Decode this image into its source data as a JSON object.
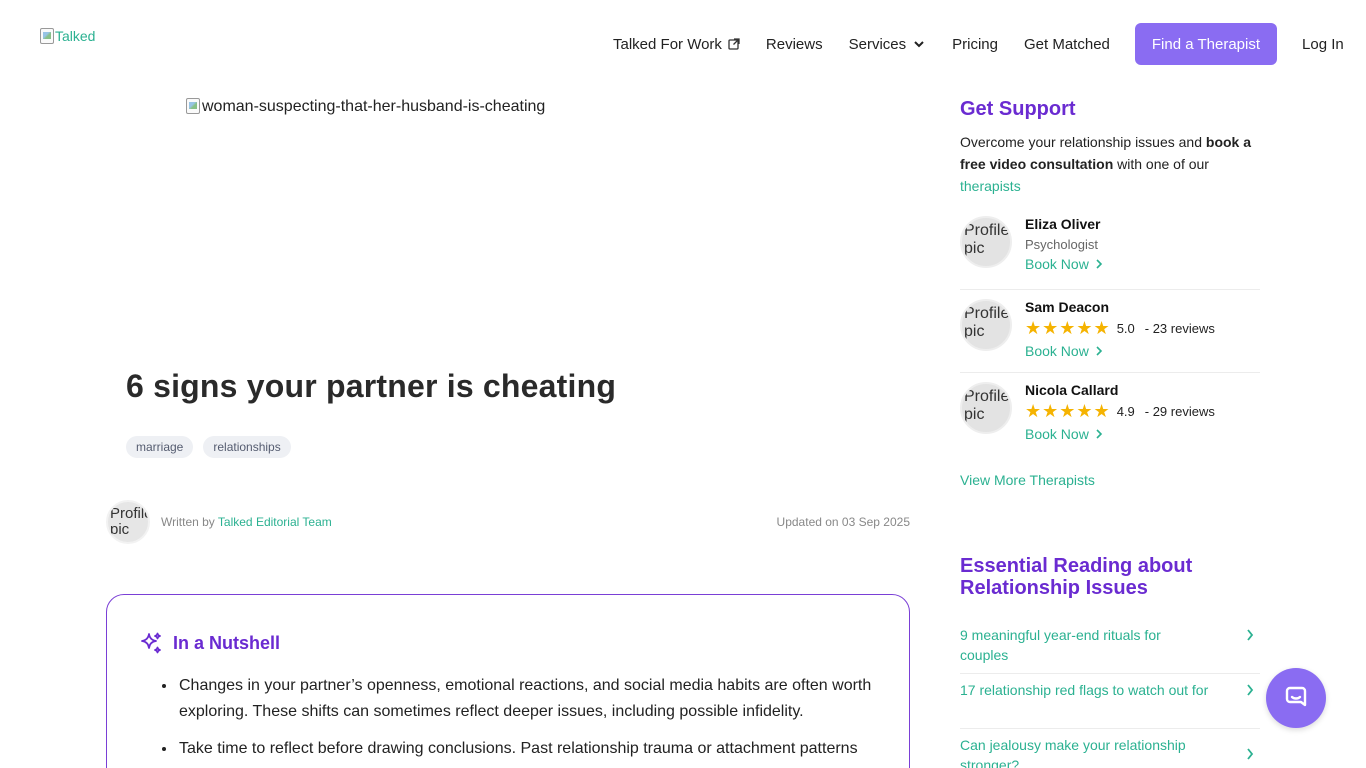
{
  "header": {
    "logo_alt": "Talked",
    "nav": {
      "work": "Talked For Work",
      "reviews": "Reviews",
      "services": "Services",
      "pricing": "Pricing",
      "matched": "Get Matched",
      "cta": "Find a Therapist",
      "login": "Log In"
    }
  },
  "article": {
    "hero_alt": "woman-suspecting-that-her-husband-is-cheating",
    "title": "6 signs your partner is cheating",
    "tags": [
      "marriage",
      "relationships"
    ],
    "author_avatar_alt": "Profile pic",
    "written_by": "Written by",
    "author": "Talked Editorial Team",
    "updated": "Updated on 03 Sep 2025",
    "nutshell": {
      "heading": "In a Nutshell",
      "items": [
        "Changes in your partner’s openness, emotional reactions, and social media habits are often worth exploring. These shifts can sometimes reflect deeper issues, including possible infidelity.",
        "Take time to reflect before drawing conclusions. Past relationship trauma or attachment patterns"
      ]
    }
  },
  "sidebar": {
    "support": {
      "heading": "Get Support",
      "intro_1": "Overcome your relationship issues and ",
      "intro_bold": "book a free video consultation",
      "intro_2": " with one of our ",
      "intro_link": "therapists"
    },
    "therapists": [
      {
        "avatar_alt": "Profile pic",
        "name": "Eliza Oliver",
        "role": "Psychologist",
        "book": "Book Now"
      },
      {
        "avatar_alt": "Profile pic",
        "name": "Sam Deacon",
        "stars": "★★★★★",
        "rating": "5.0",
        "reviews": "- 23 reviews",
        "book": "Book Now"
      },
      {
        "avatar_alt": "Profile pic",
        "name": "Nicola Callard",
        "stars": "★★★★★",
        "rating": "4.9",
        "reviews": "- 29 reviews",
        "book": "Book Now"
      }
    ],
    "view_more": "View More Therapists",
    "reading": {
      "heading": "Essential Reading about Relationship Issues",
      "items": [
        "9 meaningful year-end rituals for couples",
        "17 relationship red flags to watch out for",
        "Can jealousy make your relationship stronger?"
      ]
    }
  },
  "colors": {
    "accent_purple": "#6a2bd1",
    "button_purple": "#8a6cf2",
    "link_green": "#2bb191",
    "star_gold": "#f5b301"
  },
  "icons": {
    "external": "external-link-icon",
    "chevron": "chevron-down-icon",
    "sparkle": "sparkle-icon",
    "chat": "chat-bubble-icon"
  }
}
